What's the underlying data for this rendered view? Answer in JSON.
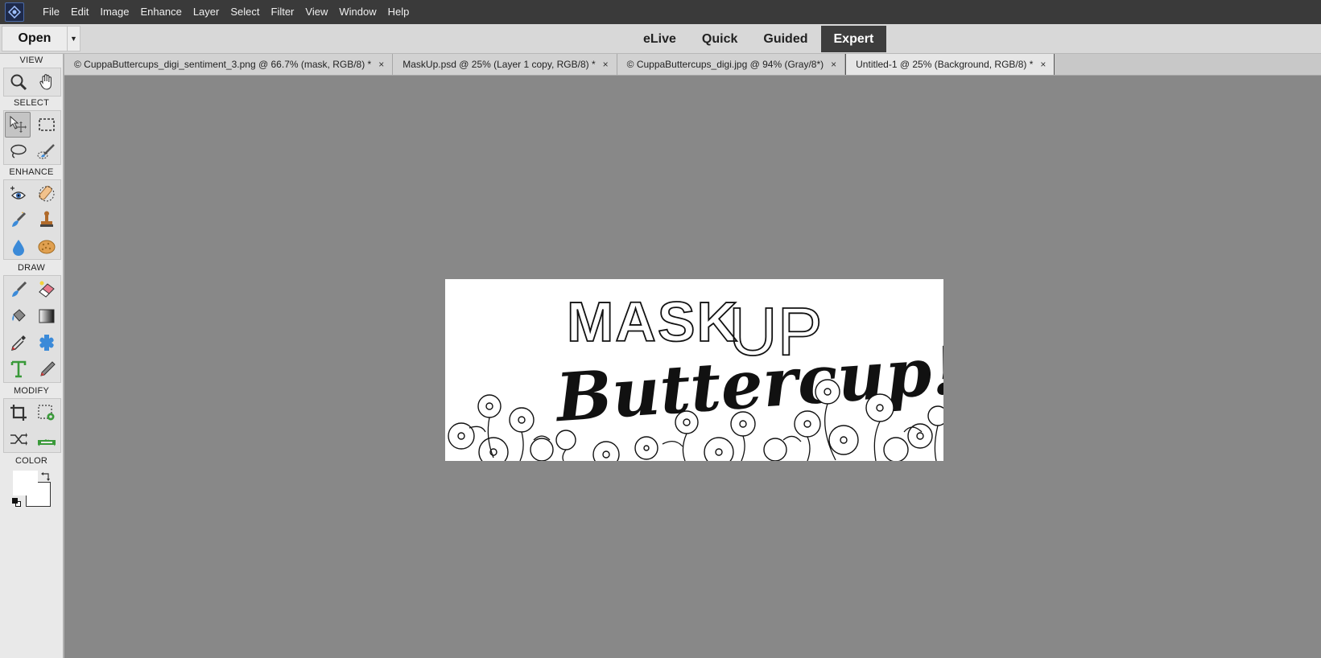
{
  "menubar": {
    "logo_icon": "photoshop-elements-logo-icon",
    "items": [
      "File",
      "Edit",
      "Image",
      "Enhance",
      "Layer",
      "Select",
      "Filter",
      "View",
      "Window",
      "Help"
    ]
  },
  "modebar": {
    "open_label": "Open",
    "open_dropdown_icon": "chevron-down-icon",
    "modes": [
      "eLive",
      "Quick",
      "Guided",
      "Expert"
    ],
    "active_mode": "Expert"
  },
  "toolpanel": {
    "sections": {
      "view": "VIEW",
      "select": "SELECT",
      "enhance": "ENHANCE",
      "draw": "DRAW",
      "modify": "MODIFY",
      "color": "COLOR"
    },
    "tools": {
      "view": [
        "zoom-tool-icon",
        "hand-tool-icon"
      ],
      "select": [
        "move-tool-icon",
        "marquee-tool-icon",
        "lasso-tool-icon",
        "quick-selection-tool-icon"
      ],
      "enhance": [
        "red-eye-tool-icon",
        "spot-healing-tool-icon",
        "smart-brush-tool-icon",
        "clone-stamp-tool-icon",
        "blur-tool-icon",
        "sponge-tool-icon"
      ],
      "draw": [
        "brush-tool-icon",
        "eraser-tool-icon",
        "paint-bucket-tool-icon",
        "gradient-tool-icon",
        "eyedropper-tool-icon",
        "custom-shape-tool-icon",
        "type-tool-icon",
        "pencil-tool-icon"
      ],
      "modify": [
        "crop-tool-icon",
        "recompose-tool-icon",
        "content-aware-move-tool-icon",
        "straighten-tool-icon"
      ]
    },
    "selected_tool": "move-tool-icon",
    "colors": {
      "foreground": "#ffffff",
      "background": "#ffffff"
    }
  },
  "doctabs": [
    {
      "label": "© CuppaButtercups_digi_sentiment_3.png @ 66.7% (mask, RGB/8) *",
      "active": false
    },
    {
      "label": "MaskUp.psd @ 25% (Layer 1 copy, RGB/8) *",
      "active": false
    },
    {
      "label": "© CuppaButtercups_digi.jpg @ 94% (Gray/8*)",
      "active": false
    },
    {
      "label": "Untitled-1 @ 25% (Background, RGB/8) *",
      "active": true
    }
  ],
  "tab_close_glyph": "×",
  "canvas": {
    "line1_left": "MASK",
    "line1_right": "UP",
    "line2": "Buttercup!"
  },
  "colors": {
    "menubar_bg": "#3a3a3a",
    "workspace_bg": "#888888",
    "active_mode_bg": "#3d3d3d"
  }
}
